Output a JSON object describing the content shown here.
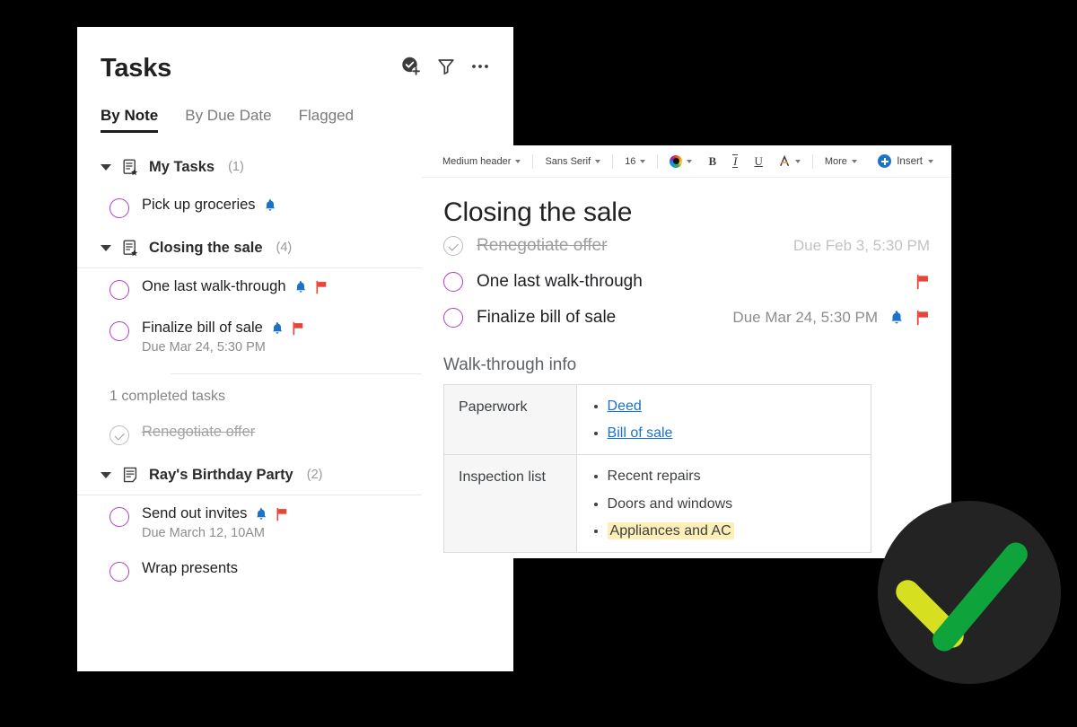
{
  "tasks_panel": {
    "title": "Tasks",
    "header_icons": [
      {
        "name": "add-task-icon",
        "label": "Add task"
      },
      {
        "name": "filter-icon",
        "label": "Filter"
      },
      {
        "name": "more-options-icon",
        "label": "More options"
      }
    ],
    "tabs": [
      {
        "label": "By Note",
        "active": true
      },
      {
        "label": "By Due Date",
        "active": false
      },
      {
        "label": "Flagged",
        "active": false
      }
    ],
    "groups": [
      {
        "name": "My Tasks",
        "count": "(1)",
        "icon": "note-starred-icon",
        "tasks": [
          {
            "text": "Pick up groceries",
            "done": false,
            "reminder": true,
            "flag": false,
            "due": ""
          }
        ]
      },
      {
        "name": "Closing the sale",
        "count": "(4)",
        "icon": "note-starred-icon",
        "tasks": [
          {
            "text": "One last walk-through",
            "done": false,
            "reminder": true,
            "flag": true,
            "due": ""
          },
          {
            "text": "Finalize bill of sale",
            "done": false,
            "reminder": true,
            "flag": true,
            "due": "Due Mar 24, 5:30 PM"
          }
        ],
        "completed_label": "1 completed tasks",
        "completed": [
          {
            "text": "Renegotiate offer",
            "done": true,
            "reminder": false,
            "flag": false,
            "due": ""
          }
        ]
      },
      {
        "name": "Ray's Birthday Party",
        "count": "(2)",
        "icon": "note-icon",
        "tasks": [
          {
            "text": "Send out invites",
            "done": false,
            "reminder": true,
            "flag": true,
            "due": "Due March 12, 10AM"
          },
          {
            "text": "Wrap presents",
            "done": false,
            "reminder": false,
            "flag": false,
            "due": ""
          }
        ]
      }
    ]
  },
  "editor_panel": {
    "toolbar": {
      "style": "Medium header",
      "font": "Sans Serif",
      "size": "16",
      "color_label": "text-color",
      "bold": "B",
      "italic": "I",
      "underline": "U",
      "highlight": "A",
      "more": "More",
      "insert": "Insert"
    },
    "note_title": "Closing the sale",
    "note_tasks": [
      {
        "text": "Renegotiate offer",
        "done": true,
        "due": "Due Feb 3, 5:30 PM",
        "reminder": false,
        "flag": false
      },
      {
        "text": "One last walk-through",
        "done": false,
        "due": "",
        "reminder": false,
        "flag": true
      },
      {
        "text": "Finalize bill of sale",
        "done": false,
        "due": "Due Mar 24, 5:30 PM",
        "reminder": true,
        "flag": true
      }
    ],
    "section_heading": "Walk-through info",
    "table": [
      {
        "key": "Paperwork",
        "items": [
          {
            "text": "Deed",
            "link": true,
            "highlight": false
          },
          {
            "text": "Bill of sale",
            "link": true,
            "highlight": false
          }
        ]
      },
      {
        "key": "Inspection list",
        "items": [
          {
            "text": "Recent repairs",
            "link": false,
            "highlight": false
          },
          {
            "text": "Doors and windows",
            "link": false,
            "highlight": false
          },
          {
            "text": "Appliances and AC",
            "link": false,
            "highlight": true
          }
        ]
      }
    ]
  },
  "check_badge": {
    "name": "tasks-check-badge",
    "circle_color": "#232323",
    "short_stroke_color": "#d7df21",
    "long_stroke_color": "#0fa33c"
  },
  "colors": {
    "background": "#000000",
    "panel": "#ffffff",
    "checkbox_purple": "#b040c8",
    "reminder_blue": "#1a73c8",
    "flag_red": "#e8443a",
    "link_blue": "#1a73c8",
    "highlight_yellow": "#fdefb6"
  }
}
